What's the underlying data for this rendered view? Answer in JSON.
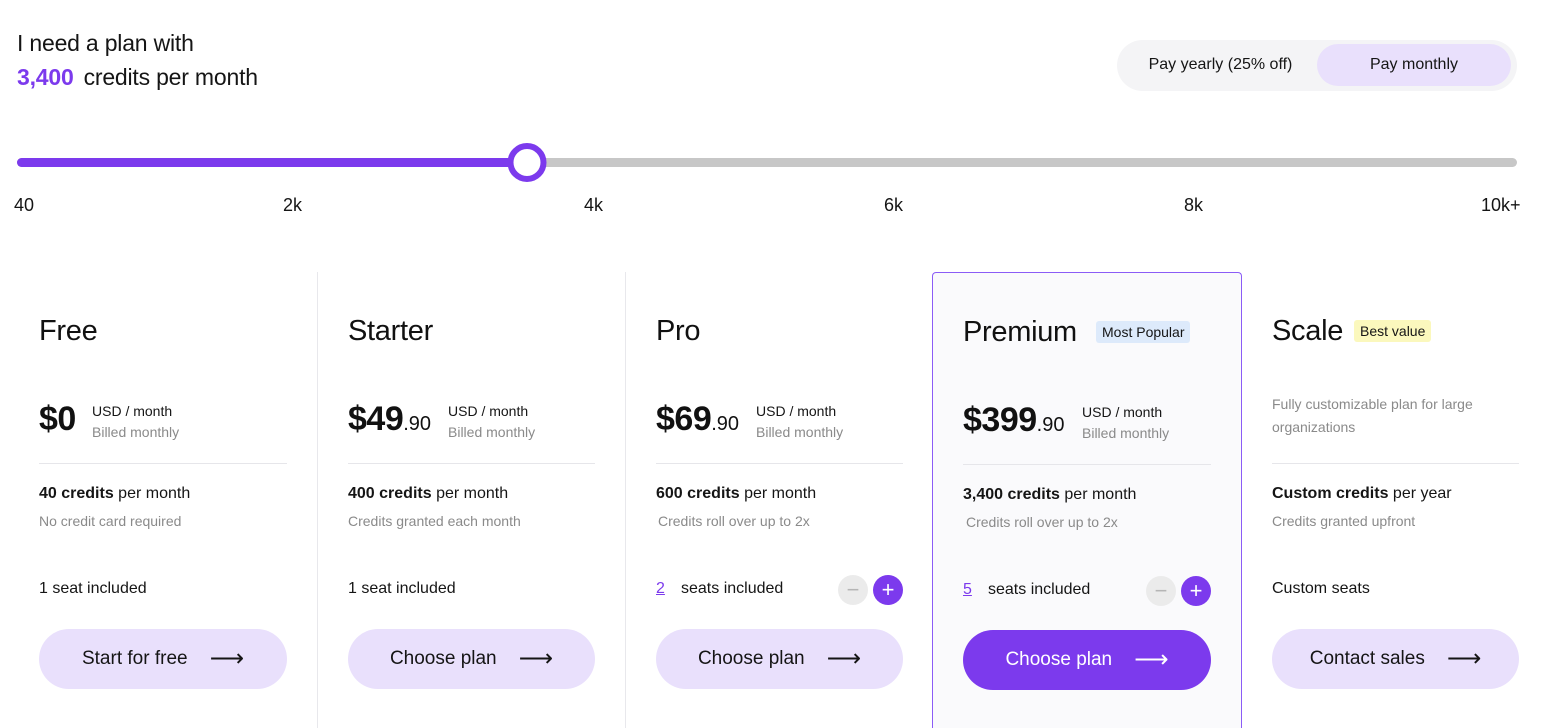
{
  "header": {
    "line1": "I need a plan with",
    "credits_value": "3,400",
    "credits_suffix": "credits per month"
  },
  "billing_toggle": {
    "yearly_label": "Pay yearly (25% off)",
    "monthly_label": "Pay monthly",
    "selected": "monthly"
  },
  "slider": {
    "min": 40,
    "max": 10000,
    "value": 3400,
    "ticks": [
      "40",
      "2k",
      "4k",
      "6k",
      "8k",
      "10k+"
    ]
  },
  "colors": {
    "accent": "#7c3aed",
    "accent_light": "#e9e0fc",
    "popular_badge": "#ddeafb",
    "value_badge": "#fbf8bd"
  },
  "plans": [
    {
      "name": "Free",
      "price_main": "$0",
      "price_cents": "",
      "unit": "USD / month",
      "billed": "Billed monthly",
      "credits_bold": "40 credits",
      "credits_suffix": "per month",
      "credits_sub": "No credit card required",
      "seats_text": "1 seat included",
      "cta": "Start for free",
      "cta_icon": "arrow-right-icon"
    },
    {
      "name": "Starter",
      "price_main": "$49",
      "price_cents": ".90",
      "unit": "USD / month",
      "billed": "Billed monthly",
      "credits_bold": "400 credits",
      "credits_suffix": "per month",
      "credits_sub": "Credits granted each month",
      "seats_text": "1 seat included",
      "cta": "Choose plan",
      "cta_icon": "arrow-right-icon"
    },
    {
      "name": "Pro",
      "price_main": "$69",
      "price_cents": ".90",
      "unit": "USD / month",
      "billed": "Billed monthly",
      "credits_bold": "600 credits",
      "credits_suffix": "per month",
      "credits_sub": "Credits roll over up to 2x",
      "seat_count": "2",
      "seat_label": "seats included",
      "stepper_minus": "−",
      "stepper_plus": "+",
      "cta": "Choose plan",
      "cta_icon": "arrow-right-icon"
    },
    {
      "name": "Premium",
      "badge": "Most Popular",
      "price_main": "$399",
      "price_cents": ".90",
      "unit": "USD / month",
      "billed": "Billed monthly",
      "credits_bold": "3,400 credits",
      "credits_suffix": "per month",
      "credits_sub": "Credits roll over up to 2x",
      "seat_count": "5",
      "seat_label": "seats included",
      "stepper_minus": "−",
      "stepper_plus": "+",
      "cta": "Choose plan",
      "cta_icon": "arrow-right-icon"
    },
    {
      "name": "Scale",
      "badge": "Best value",
      "description": "Fully customizable plan for large organizations",
      "credits_bold": "Custom credits",
      "credits_suffix": "per year",
      "credits_sub": "Credits granted upfront",
      "seats_text": "Custom seats",
      "cta": "Contact sales",
      "cta_icon": "arrow-right-icon"
    }
  ]
}
